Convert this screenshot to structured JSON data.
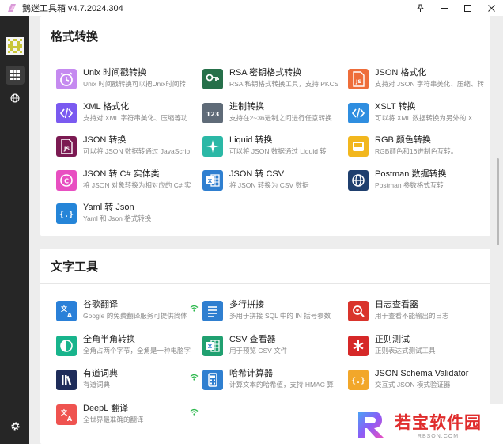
{
  "window": {
    "title": "鹅迷工具箱 v4.7.2024.304",
    "controls": [
      "pin-icon",
      "minimize-icon",
      "maximize-icon",
      "close-icon"
    ]
  },
  "sidebar": {
    "items": [
      {
        "name": "apps-grid-icon",
        "active": true
      },
      {
        "name": "globe-icon",
        "active": false
      },
      {
        "name": "gear-icon",
        "active": false
      }
    ]
  },
  "sections": [
    {
      "title": "格式转换",
      "tools": [
        {
          "name": "Unix 时间戳转换",
          "desc": "Unix 时间戳转换可以把Unix时间转",
          "icon": "alarm-clock-icon",
          "color": "#c58af0"
        },
        {
          "name": "RSA 密钥格式转换",
          "desc": "RSA 私钥格式转换工具，支持 PKCS",
          "icon": "key-icon",
          "color": "#26704a"
        },
        {
          "name": "JSON 格式化",
          "desc": "支持对 JSON 字符串美化、压缩、转",
          "icon": "js-file-icon",
          "color": "#ee6d3a"
        },
        {
          "name": "XML 格式化",
          "desc": "支持对 XML 字符串美化、压缩等功",
          "icon": "code-icon",
          "color": "#7a5af0"
        },
        {
          "name": "进制转换",
          "desc": "支持在2~36进制之间进行任意转换",
          "icon": "number-123-icon",
          "color": "#5f6b78"
        },
        {
          "name": "XSLT 转换",
          "desc": "可以将 XML 数据转换为另外的 X",
          "icon": "code-icon",
          "color": "#2f8ee0"
        },
        {
          "name": "JSON 转换",
          "desc": "可以将 JSON 数据转通过 JavaScrip",
          "icon": "js-file-icon",
          "color": "#7b1a52"
        },
        {
          "name": "Liquid 转换",
          "desc": "可以将 JSON 数据通过 Liquid 转",
          "icon": "sparkle-icon",
          "color": "#2bb8a6"
        },
        {
          "name": "RGB 颜色转换",
          "desc": "RGB颜色和16进制色互转。",
          "icon": "palette-icon",
          "color": "#f2b71e"
        },
        {
          "name": "JSON 转 C# 实体类",
          "desc": "将 JSON 对象转换为相对应的 C# 实",
          "icon": "csharp-icon",
          "color": "#e84fc1"
        },
        {
          "name": "JSON 转 CSV",
          "desc": "将 JSON 转换为 CSV 数据",
          "icon": "excel-icon",
          "color": "#2f7fd0"
        },
        {
          "name": "Postman 数据转换",
          "desc": "Postman 参数格式互转",
          "icon": "globe-icon",
          "color": "#1f3f6e"
        },
        {
          "name": "Yaml 转 Json",
          "desc": "Yaml 和 Json 格式转换",
          "icon": "braces-icon",
          "color": "#2585d8"
        }
      ]
    },
    {
      "title": "文字工具",
      "tools": [
        {
          "name": "谷歌翻译",
          "desc": "Google 的免费翻译服务可提供简体",
          "icon": "translate-icon",
          "color": "#2a80d8",
          "wifi": true
        },
        {
          "name": "多行拼接",
          "desc": "多用于拼接 SQL 中的 IN 括号参数",
          "icon": "lines-icon",
          "color": "#2f7fd0"
        },
        {
          "name": "日志查看器",
          "desc": "用于查看不能输出的日志",
          "icon": "magnifier-icon",
          "color": "#d9342c"
        },
        {
          "name": "全角半角转换",
          "desc": "全角占两个字节，全角是一种电脑字",
          "icon": "half-circle-icon",
          "color": "#18b48c"
        },
        {
          "name": "CSV 查看器",
          "desc": "用于预览 CSV 文件",
          "icon": "excel-icon",
          "color": "#20a070"
        },
        {
          "name": "正则测试",
          "desc": "正则表达式测试工具",
          "icon": "asterisk-icon",
          "color": "#d62828"
        },
        {
          "name": "有道词典",
          "desc": "有道词典",
          "icon": "books-icon",
          "color": "#1e2c5a",
          "wifi": true
        },
        {
          "name": "哈希计算器",
          "desc": "计算文本的哈希值，支持 HMAC 算",
          "icon": "calculator-icon",
          "color": "#2f7fd0"
        },
        {
          "name": "JSON Schema Validator",
          "desc": "交互式 JSON 模式验证器",
          "icon": "braces-icon",
          "color": "#f2a72a"
        },
        {
          "name": "DeepL 翻译",
          "desc": "全世界最准确的翻译",
          "icon": "translate-icon",
          "color": "#ef5350",
          "wifi": true
        }
      ]
    }
  ],
  "watermark": {
    "big": "若宝软件园",
    "small": "RBSON.COM",
    "logo": "R"
  }
}
